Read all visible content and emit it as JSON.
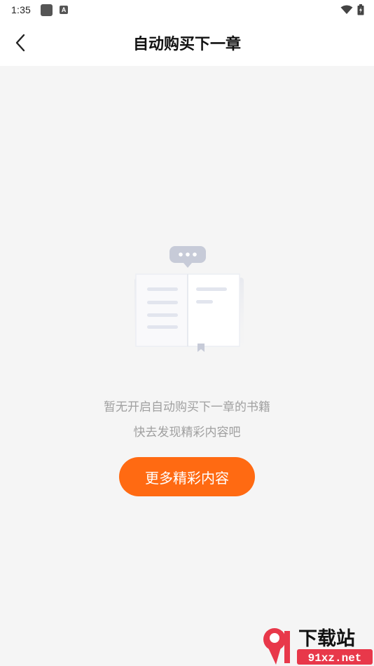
{
  "status_bar": {
    "time": "1:35",
    "notification_icons": [
      "app-square-icon",
      "a-badge-icon"
    ],
    "badge_letter": "A",
    "right_icons": [
      "wifi-icon",
      "battery-charging-icon"
    ]
  },
  "header": {
    "title": "自动购买下一章",
    "back_icon": "chevron-left-icon"
  },
  "empty_state": {
    "illustration": "open-book-with-chat-bubble",
    "message_line1": "暂无开启自动购买下一章的书籍",
    "message_line2": "快去发现精彩内容吧",
    "button_label": "更多精彩内容"
  },
  "watermark": {
    "logo_text": "下载站",
    "url": "91xz.net"
  },
  "colors": {
    "accent": "#ff6a12",
    "background": "#f5f5f5",
    "header_bg": "#ffffff",
    "muted_text": "#a0a0a0",
    "title_text": "#111111"
  }
}
